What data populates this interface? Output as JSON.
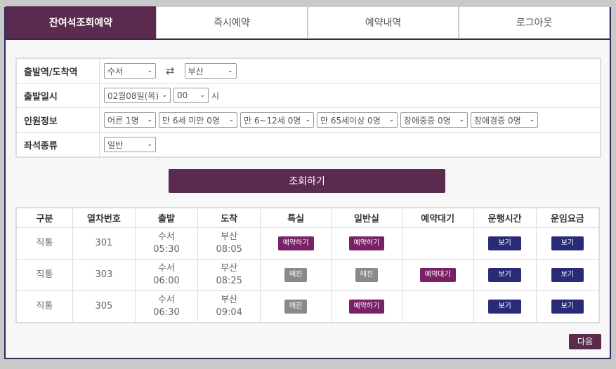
{
  "tabs": [
    "잔여석조회예약",
    "즉시예약",
    "예약내역",
    "로그아웃"
  ],
  "form": {
    "route_label": "출발역/도착역",
    "departure": "수서",
    "arrival": "부산",
    "datetime_label": "출발일시",
    "date": "02월08일(목)",
    "hour": "00",
    "hour_unit": "시",
    "people_label": "인원정보",
    "people": [
      "어른 1명",
      "만 6세 미만 0명",
      "만 6~12세 0명",
      "만 65세이상 0명",
      "장애중증 0명",
      "장애경증 0명"
    ],
    "seat_label": "좌석종류",
    "seat": "일반"
  },
  "search_label": "조회하기",
  "table": {
    "headers": [
      "구분",
      "열차번호",
      "출발",
      "도착",
      "특실",
      "일반실",
      "예약대기",
      "운행시간",
      "운임요금"
    ],
    "rows": [
      {
        "type": "직통",
        "train": "301",
        "dep_station": "수서",
        "dep_time": "05:30",
        "arr_station": "부산",
        "arr_time": "08:05",
        "special": "예약하기",
        "general": "예약하기",
        "wait": "",
        "time_btn": "보기",
        "fare_btn": "보기"
      },
      {
        "type": "직통",
        "train": "303",
        "dep_station": "수서",
        "dep_time": "06:00",
        "arr_station": "부산",
        "arr_time": "08:25",
        "special": "매진",
        "general": "매진",
        "wait": "예약대기",
        "time_btn": "보기",
        "fare_btn": "보기"
      },
      {
        "type": "직통",
        "train": "305",
        "dep_station": "수서",
        "dep_time": "06:30",
        "arr_station": "부산",
        "arr_time": "09:04",
        "special": "매진",
        "general": "예약하기",
        "wait": "",
        "time_btn": "보기",
        "fare_btn": "보기"
      }
    ]
  },
  "next_label": "다음",
  "colors": {
    "primary": "#5a2a4f",
    "reserve": "#7a2067",
    "soldout": "#8a8a8a",
    "view": "#2a2b78"
  },
  "icons": {
    "swap": "swap-icon",
    "dropdown": "chevron-down-icon"
  }
}
